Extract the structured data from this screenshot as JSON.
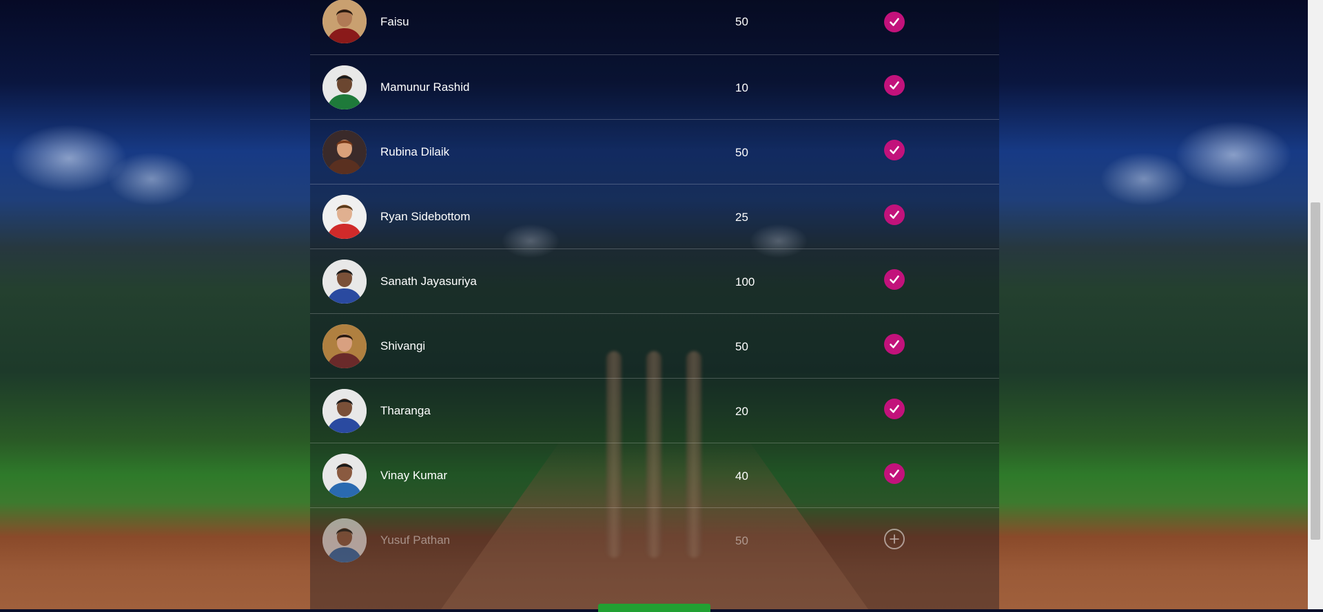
{
  "players": [
    {
      "name": "Faisu",
      "points": "50",
      "selected": true,
      "skin": "#b07a55",
      "shirt": "#8a1a1a",
      "hair": "#2a1a10",
      "bg": "#c9a070"
    },
    {
      "name": "Mamunur Rashid",
      "points": "10",
      "selected": true,
      "skin": "#6b4630",
      "shirt": "#1e7a3a",
      "hair": "#1a1a1a",
      "bg": "#e8e8e8"
    },
    {
      "name": "Rubina Dilaik",
      "points": "50",
      "selected": true,
      "skin": "#d9a07a",
      "shirt": "#5a3020",
      "hair": "#7a3a1a",
      "bg": "#3a2a2a"
    },
    {
      "name": "Ryan Sidebottom",
      "points": "25",
      "selected": true,
      "skin": "#e0b090",
      "shirt": "#d02a2a",
      "hair": "#5a3a1a",
      "bg": "#f0f0f0"
    },
    {
      "name": "Sanath Jayasuriya",
      "points": "100",
      "selected": true,
      "skin": "#7a5038",
      "shirt": "#2a4aa0",
      "hair": "#1a1a1a",
      "bg": "#e8e8e8"
    },
    {
      "name": "Shivangi",
      "points": "50",
      "selected": true,
      "skin": "#d8a080",
      "shirt": "#6a2a2a",
      "hair": "#2a1a10",
      "bg": "#b08040"
    },
    {
      "name": "Tharanga",
      "points": "20",
      "selected": true,
      "skin": "#7a5038",
      "shirt": "#2a4aa0",
      "hair": "#1a1a1a",
      "bg": "#e8e8e8"
    },
    {
      "name": "Vinay Kumar",
      "points": "40",
      "selected": true,
      "skin": "#8a5a40",
      "shirt": "#2a6ab0",
      "hair": "#1a1a1a",
      "bg": "#e8e8e8"
    },
    {
      "name": "Yusuf Pathan",
      "points": "50",
      "selected": false,
      "skin": "#8a5a40",
      "shirt": "#2a6ab0",
      "hair": "#1a1a1a",
      "bg": "#e8e8e8"
    }
  ],
  "colors": {
    "selected": "#c2127b",
    "submit": "#22a032"
  },
  "icons": {
    "selected": "check-icon",
    "unselected": "plus-circle-icon"
  }
}
